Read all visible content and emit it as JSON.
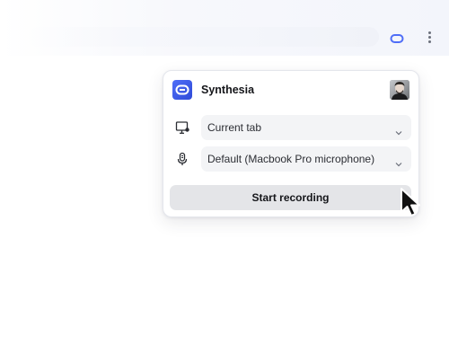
{
  "browser": {
    "extension_icon": "synthesia-extension-icon",
    "menu_icon": "more-vert-icon"
  },
  "popup": {
    "app_name": "Synthesia",
    "brand_color": "#3f5cf0",
    "source_select": {
      "value": "Current tab",
      "icon": "monitor-icon"
    },
    "mic_select": {
      "value": "Default (Macbook Pro microphone)",
      "icon": "microphone-icon"
    },
    "start_button_label": "Start recording"
  }
}
